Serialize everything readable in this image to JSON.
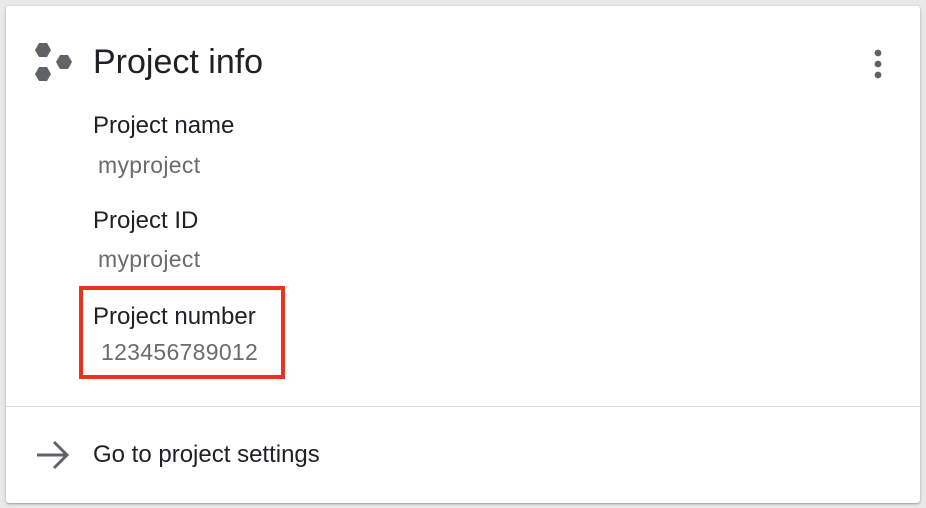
{
  "card": {
    "title": "Project info",
    "title_icon": "project-hexagons-icon",
    "menu_icon": "more-vert-icon"
  },
  "fields": {
    "name": {
      "label": "Project name",
      "value": "myproject"
    },
    "id": {
      "label": "Project ID",
      "value": "myproject"
    },
    "number": {
      "label": "Project number",
      "value": "123456789012"
    }
  },
  "footer": {
    "link_label": "Go to project settings",
    "link_icon": "arrow-right-icon"
  },
  "colors": {
    "highlight": "#e8341c",
    "icon": "#5f6368",
    "text_primary": "#202124",
    "text_secondary": "#6b6b6b"
  }
}
